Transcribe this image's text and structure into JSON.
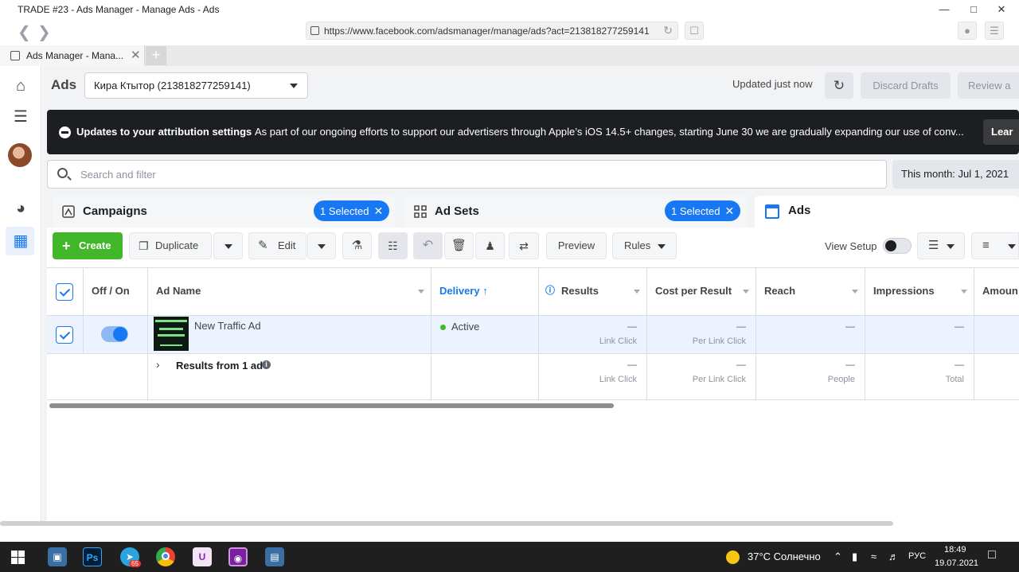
{
  "window": {
    "title": "TRADE #23 - Ads Manager - Manage Ads - Ads",
    "url": "https://www.facebook.com/adsmanager/manage/ads?act=213818277259141",
    "tab_label": "Ads Manager - Mana..."
  },
  "header": {
    "title": "Ads",
    "account": "Кира Ктытор (213818277259141)",
    "updated": "Updated just now",
    "discard": "Discard Drafts",
    "review": "Review a"
  },
  "banner": {
    "title": "Updates to your attribution settings",
    "message": "As part of our ongoing efforts to support our advertisers through Apple’s iOS 14.5+ changes, starting June 30 we are gradually expanding our use of conv...",
    "learn": "Lear"
  },
  "search": {
    "placeholder": "Search and filter",
    "date": "This month: Jul 1, 2021"
  },
  "tabs": [
    {
      "label": "Campaigns",
      "selected": "1 Selected"
    },
    {
      "label": "Ad Sets",
      "selected": "1 Selected"
    },
    {
      "label": "Ads"
    }
  ],
  "toolbar": {
    "create": "Create",
    "duplicate": "Duplicate",
    "edit": "Edit",
    "preview": "Preview",
    "rules": "Rules",
    "view_setup": "View Setup"
  },
  "table": {
    "headers": {
      "off_on": "Off / On",
      "ad_name": "Ad Name",
      "delivery": "Delivery",
      "results": "Results",
      "cost": "Cost per Result",
      "reach": "Reach",
      "impressions": "Impressions",
      "amount": "Amoun"
    },
    "row": {
      "name": "New Traffic Ad",
      "delivery": "Active",
      "results": "—",
      "results_sub": "Link Click",
      "cost": "—",
      "cost_sub": "Per Link Click",
      "reach": "—",
      "impressions": "—"
    },
    "summary": {
      "label": "Results from 1 ad",
      "results": "—",
      "results_sub": "Link Click",
      "cost": "—",
      "cost_sub": "Per Link Click",
      "reach": "—",
      "reach_sub": "People",
      "impressions": "—",
      "impressions_sub": "Total"
    }
  },
  "taskbar": {
    "weather": "37°C  Солнечно",
    "lang": "РУС",
    "time": "18:49",
    "date": "19.07.2021",
    "badge": "65"
  },
  "colors": {
    "primary": "#1877f2",
    "create": "#42b72a",
    "banner": "#1c1e21",
    "active_dot": "#42b72a"
  }
}
